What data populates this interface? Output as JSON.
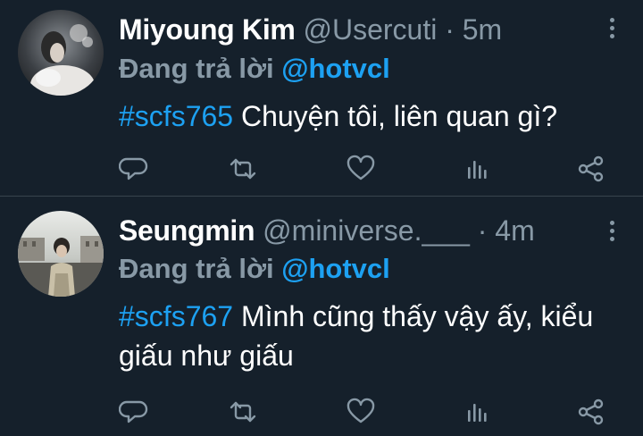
{
  "tweets": [
    {
      "display_name": "Miyoung Kim",
      "handle": "@Usercuti",
      "separator": "·",
      "time": "5m",
      "reply_prefix": "Đang trả lời",
      "reply_to": "@hotvcl",
      "hashtag": "#scfs765",
      "text": " Chuyện tôi, liên quan gì?"
    },
    {
      "display_name": "Seungmin",
      "handle": "@miniverse.___",
      "separator": "·",
      "time": "4m",
      "reply_prefix": "Đang trả lời",
      "reply_to": "@hotvcl",
      "hashtag": "#scfs767",
      "text": " Mình cũng thấy vậy ấy, kiểu giấu như giấu"
    }
  ],
  "actions": [
    "reply-icon",
    "retweet-icon",
    "like-icon",
    "stats-icon",
    "share-icon"
  ],
  "colors": {
    "background": "#15202b",
    "divider": "#38444d",
    "accent": "#1da1f2",
    "secondary_text": "#8899a6"
  }
}
